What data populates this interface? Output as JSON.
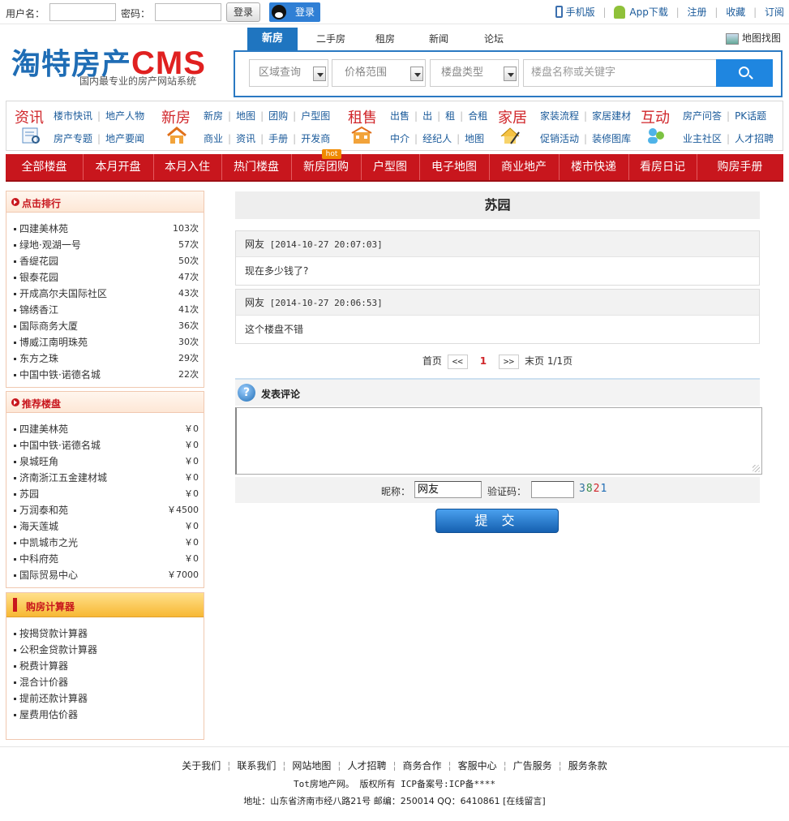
{
  "topbar": {
    "username_label": "用户名：",
    "password_label": "密码：",
    "login_label": "登录",
    "qq_login_label": "登录",
    "links": [
      "手机版",
      "App下载",
      "注册",
      "收藏",
      "订阅"
    ]
  },
  "logo": {
    "name_cn": "淘特房产",
    "name_en": "CMS",
    "slogan": "国内最专业的房产网站系统"
  },
  "search": {
    "tabs": [
      "新房",
      "二手房",
      "租房",
      "新闻",
      "论坛"
    ],
    "active_tab": "新房",
    "map_link": "地图找图",
    "selects": [
      "区域查询",
      "价格范围",
      "楼盘类型"
    ],
    "keyword_placeholder": "楼盘名称或关键字"
  },
  "categories": [
    {
      "title": "资讯",
      "row1": [
        "楼市快讯",
        "地产人物"
      ],
      "row2": [
        "房产专题",
        "地产要闻"
      ]
    },
    {
      "title": "新房",
      "row1": [
        "新房",
        "地图",
        "团购",
        "户型图"
      ],
      "row2": [
        "商业",
        "资讯",
        "手册",
        "开发商"
      ]
    },
    {
      "title": "租售",
      "row1": [
        "出售",
        "出",
        "租",
        "合租"
      ],
      "row2": [
        "中介",
        "经纪人",
        "地图"
      ]
    },
    {
      "title": "家居",
      "row1": [
        "家装流程",
        "家居建材"
      ],
      "row2": [
        "促销活动",
        "装修图库"
      ]
    },
    {
      "title": "互动",
      "row1": [
        "房产问答",
        "PK话题"
      ],
      "row2": [
        "业主社区",
        "人才招聘"
      ]
    }
  ],
  "mainnav": {
    "items": [
      "全部楼盘",
      "本月开盘",
      "本月入住",
      "热门楼盘",
      "新房团购",
      "户型图",
      "电子地图",
      "商业地产",
      "楼市快递",
      "看房日记",
      "购房手册"
    ],
    "hot_badge": "hot"
  },
  "sidebar": {
    "ranking": {
      "title": "点击排行",
      "items": [
        {
          "name": "四建美林苑",
          "value": "103次"
        },
        {
          "name": "绿地·观湖一号",
          "value": "57次"
        },
        {
          "name": "香缇花园",
          "value": "50次"
        },
        {
          "name": "银泰花园",
          "value": "47次"
        },
        {
          "name": "开成高尔夫国际社区",
          "value": "43次"
        },
        {
          "name": "锦绣香江",
          "value": "41次"
        },
        {
          "name": "国际商务大厦",
          "value": "36次"
        },
        {
          "name": "博威江南明珠苑",
          "value": "30次"
        },
        {
          "name": "东方之珠",
          "value": "29次"
        },
        {
          "name": "中国中铁·诺德名城",
          "value": "22次"
        }
      ]
    },
    "recommend": {
      "title": "推荐楼盘",
      "items": [
        {
          "name": "四建美林苑",
          "value": "￥0"
        },
        {
          "name": "中国中铁·诺德名城",
          "value": "￥0"
        },
        {
          "name": "泉城旺角",
          "value": "￥0"
        },
        {
          "name": "济南浙江五金建材城",
          "value": "￥0"
        },
        {
          "name": "苏园",
          "value": "￥0"
        },
        {
          "name": "万润泰和苑",
          "value": "￥4500"
        },
        {
          "name": "海天莲城",
          "value": "￥0"
        },
        {
          "name": "中凯城市之光",
          "value": "￥0"
        },
        {
          "name": "中科府苑",
          "value": "￥0"
        },
        {
          "name": "国际贸易中心",
          "value": "￥7000"
        }
      ]
    },
    "calculators": {
      "title": "购房计算器",
      "items": [
        "按揭贷款计算器",
        "公积金贷款计算器",
        "税费计算器",
        "混合计价器",
        "提前还款计算器",
        "屋费用估价器"
      ]
    }
  },
  "main": {
    "title": "苏园",
    "comments": [
      {
        "user": "网友",
        "time": "[2014-10-27 20:07:03]",
        "text": "现在多少钱了?"
      },
      {
        "user": "网友",
        "time": "[2014-10-27 20:06:53]",
        "text": "这个楼盘不错"
      }
    ],
    "pager": {
      "first": "首页",
      "prev": "<<",
      "current": "1",
      "next": ">>",
      "last": "末页",
      "info": "1/1页"
    },
    "post": {
      "title": "发表评论",
      "nick_label": "昵称：",
      "nick_value": "网友",
      "code_label": "验证码：",
      "captcha": [
        "3",
        "8",
        "2",
        "1"
      ],
      "captcha_colors": [
        "#2f6f9f",
        "#3a8f4a",
        "#d0262a",
        "#1f6db5"
      ],
      "submit_label": "提 交"
    }
  },
  "footer": {
    "links": [
      "关于我们",
      "联系我们",
      "网站地图",
      "人才招聘",
      "商务合作",
      "客服中心",
      "广告服务",
      "服务条款"
    ],
    "copyright": "Tot房地产网。 版权所有 ICP备案号:ICP备****",
    "address": "地址：山东省济南市经八路21号 邮编：250014 QQ：6410861 [在线留言]"
  }
}
